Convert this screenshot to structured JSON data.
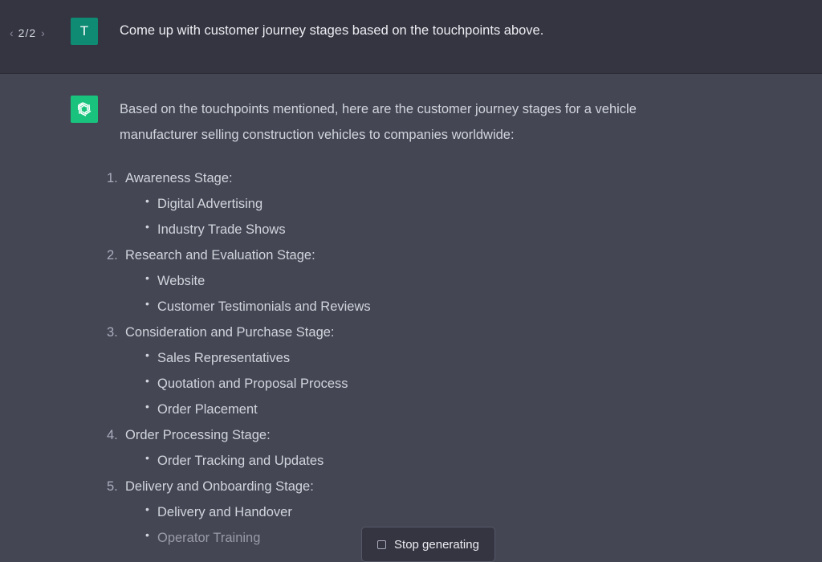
{
  "user_message": {
    "pager": {
      "prev_icon": "chevron-left",
      "count": "2/2",
      "next_icon": "chevron-right"
    },
    "avatar_letter": "T",
    "text": "Come up with customer journey stages based on the touchpoints above."
  },
  "assistant_message": {
    "avatar_icon": "openai-logo",
    "intro": "Based on the touchpoints mentioned, here are the customer journey stages for a vehicle manufacturer selling construction vehicles to companies worldwide:",
    "stages": [
      {
        "num": "1.",
        "title": "Awareness Stage:",
        "points": [
          "Digital Advertising",
          "Industry Trade Shows"
        ]
      },
      {
        "num": "2.",
        "title": "Research and Evaluation Stage:",
        "points": [
          "Website",
          "Customer Testimonials and Reviews"
        ]
      },
      {
        "num": "3.",
        "title": "Consideration and Purchase Stage:",
        "points": [
          "Sales Representatives",
          "Quotation and Proposal Process",
          "Order Placement"
        ]
      },
      {
        "num": "4.",
        "title": "Order Processing Stage:",
        "points": [
          "Order Tracking and Updates"
        ]
      },
      {
        "num": "5.",
        "title": "Delivery and Onboarding Stage:",
        "points": [
          "Delivery and Handover",
          "Operator Training"
        ]
      }
    ]
  },
  "stop_button": {
    "icon": "stop-square",
    "label": "Stop generating"
  },
  "colors": {
    "user_bg": "#343541",
    "assistant_bg": "#444654",
    "user_avatar": "#0f8b74",
    "gpt_avatar": "#19c37d"
  }
}
